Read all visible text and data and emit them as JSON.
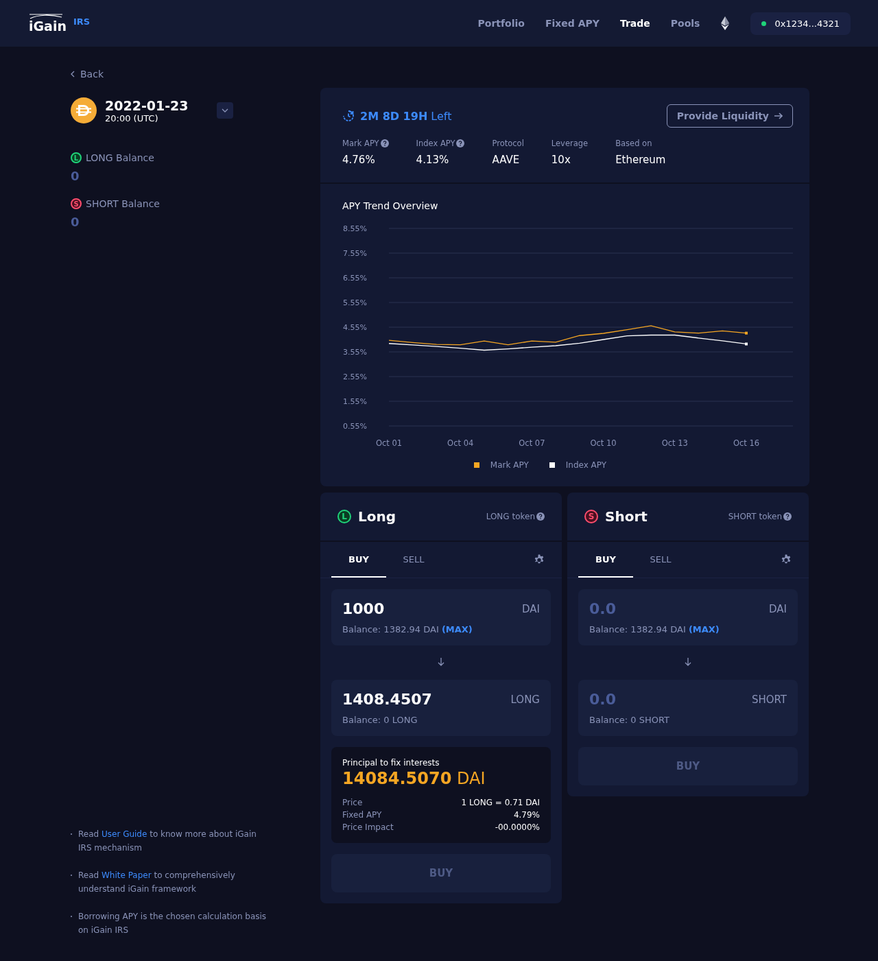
{
  "header": {
    "logo": "iGain",
    "product": "IRS",
    "nav": [
      {
        "label": "Portfolio",
        "selected": false
      },
      {
        "label": "Fixed APY",
        "selected": false
      },
      {
        "label": "Trade",
        "selected": true
      },
      {
        "label": "Pools",
        "selected": false
      }
    ],
    "wallet": {
      "address": "0x1234...4321",
      "connected": true
    }
  },
  "sidebar": {
    "back": "Back",
    "pool": {
      "date": "2022-01-23",
      "time": "20:00 (UTC)"
    },
    "balances": [
      {
        "kind": "long",
        "badge": "L",
        "label": "LONG Balance",
        "value": "0"
      },
      {
        "kind": "short",
        "badge": "S",
        "label": "SHORT Balance",
        "value": "0"
      }
    ],
    "notes": [
      {
        "before": "Read ",
        "link": "User Guide",
        "after": " to know more about iGain IRS mechanism"
      },
      {
        "before": "Read ",
        "link": "White Paper",
        "after": " to comprehensively understand iGain framework"
      },
      {
        "before": "Borrowing APY is the chosen calculation basis on iGain IRS"
      }
    ]
  },
  "market": {
    "countdown": "**2M 8D 19H** Left",
    "provide_button": "Provide Liquidity",
    "stats": [
      {
        "label": "Mark APY",
        "help": true,
        "value": "4.76%"
      },
      {
        "label": "Index APY",
        "help": true,
        "value": "4.13%"
      },
      {
        "label": "Protocol",
        "help": false,
        "value": "AAVE"
      },
      {
        "label": "Leverage",
        "help": false,
        "value": "10x"
      },
      {
        "label": "Based on",
        "help": false,
        "value": "Ethereum"
      }
    ]
  },
  "chart": {
    "title": "APY Trend Overview",
    "chart_data": {
      "type": "line",
      "categories": [
        "Oct 01",
        null,
        null,
        "Oct 04",
        null,
        null,
        "Oct 07",
        null,
        null,
        "Oct 10",
        null,
        null,
        "Oct 13",
        null,
        null,
        "Oct 16"
      ],
      "series": [
        {
          "name": "Mark APY",
          "color": "#f5a623",
          "values": [
            4.02,
            3.93,
            3.85,
            3.84,
            3.99,
            3.84,
            3.99,
            3.94,
            4.21,
            4.3,
            4.45,
            4.61,
            4.36,
            4.31,
            4.4,
            4.31
          ]
        },
        {
          "name": "Index APY",
          "color": "#ffffff",
          "values": [
            3.89,
            3.83,
            3.77,
            3.7,
            3.62,
            3.67,
            3.74,
            3.8,
            3.9,
            4.05,
            4.2,
            4.23,
            4.23,
            4.11,
            4.0,
            3.87
          ]
        }
      ],
      "ylim": [
        0.55,
        8.55
      ],
      "grid": true,
      "yticks": [
        {
          "value": 0.55,
          "label": "0.55%"
        },
        {
          "value": 1.55,
          "label": "1.55%"
        },
        {
          "value": 2.55,
          "label": "2.55%"
        },
        {
          "value": 3.55,
          "label": "3.55%"
        },
        {
          "value": 4.55,
          "label": "4.55%"
        },
        {
          "value": 5.55,
          "label": "5.55%"
        },
        {
          "value": 6.55,
          "label": "6.55%"
        },
        {
          "value": 7.55,
          "label": "7.55%"
        },
        {
          "value": 8.55,
          "label": "8.55%"
        }
      ]
    }
  },
  "panels": [
    {
      "kind": "long",
      "badge": "L",
      "title": "Long",
      "token_label": "LONG token",
      "tabs": [
        {
          "label": "BUY",
          "selected": true
        },
        {
          "label": "SELL",
          "selected": false
        }
      ],
      "pay": {
        "value": "1000",
        "unit": "DAI",
        "balance": "Balance: 1382.94 DAI",
        "max": "(MAX)"
      },
      "receive": {
        "value": "1408.4507",
        "unit": "LONG",
        "balance": "Balance: 0 LONG"
      },
      "summary": {
        "title": "Principal to fix interests",
        "amount": "14084.5070",
        "unit": "DAI",
        "rows": [
          {
            "label": "Price",
            "value": "1 LONG = 0.71 DAI"
          },
          {
            "label": "Fixed APY",
            "value": "4.79%"
          },
          {
            "label": "Price Impact",
            "value": "-00.0000%"
          }
        ]
      },
      "action": {
        "label": "BUY",
        "disabled": true
      }
    },
    {
      "kind": "short",
      "badge": "S",
      "title": "Short",
      "token_label": "SHORT token",
      "tabs": [
        {
          "label": "BUY",
          "selected": true
        },
        {
          "label": "SELL",
          "selected": false
        }
      ],
      "pay": {
        "placeholder": "0.0",
        "unit": "DAI",
        "balance": "Balance: 1382.94 DAI",
        "max": "(MAX)"
      },
      "receive": {
        "placeholder": "0.0",
        "unit": "SHORT",
        "balance": "Balance: 0 SHORT"
      },
      "action": {
        "label": "BUY",
        "disabled": true
      }
    }
  ]
}
